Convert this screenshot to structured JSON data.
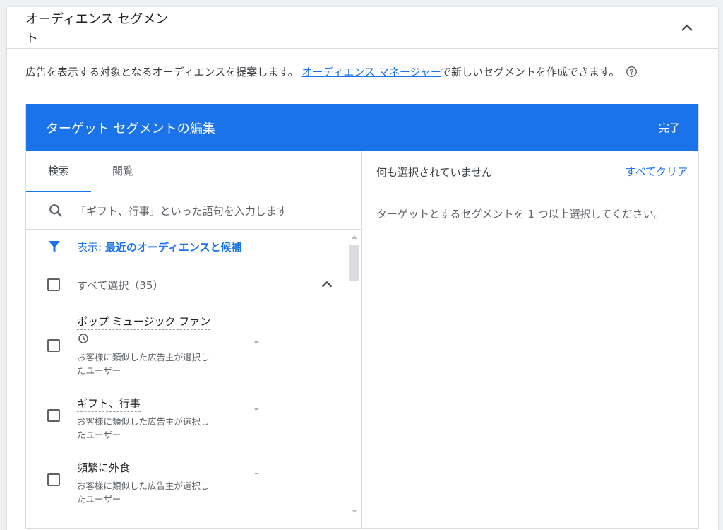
{
  "card": {
    "title": "オーディエンス セグメント",
    "description_prefix": "広告を表示する対象となるオーディエンスを提案します。 ",
    "link_text": "オーディエンス マネージャー",
    "description_suffix": "で新しいセグメントを作成できます。"
  },
  "panel": {
    "title": "ターゲット セグメントの編集",
    "done_label": "完了",
    "tabs": [
      {
        "label": "検索",
        "active": true
      },
      {
        "label": "閲覧",
        "active": false
      }
    ],
    "search": {
      "placeholder": "「ギフト、行事」といった語句を入力します",
      "value": ""
    },
    "filter": {
      "prefix": "表示: ",
      "value": "最近のオーディエンスと候補"
    },
    "select_all_label": "すべて選択（35）",
    "items": [
      {
        "name": "ポップ ミュージック ファン",
        "has_clock_icon": true,
        "sub1": "お客様に類似した広告主が選択し",
        "sub2": "たユーザー",
        "value": "–"
      },
      {
        "name": "ギフト、行事",
        "has_clock_icon": false,
        "sub1": "お客様に類似した広告主が選択し",
        "sub2": "たユーザー",
        "value": "–"
      },
      {
        "name": "頻繁に外食",
        "has_clock_icon": false,
        "sub1": "お客様に類似した広告主が選択し",
        "sub2": "たユーザー",
        "value": "–"
      }
    ],
    "right": {
      "status": "何も選択されていません",
      "clear_all_label": "すべてクリア",
      "empty_message": "ターゲットとするセグメントを 1 つ以上選択してください。"
    }
  },
  "colors": {
    "accent": "#1a73e8",
    "text": "#3c4043",
    "muted": "#5f6368",
    "divider": "#dadce0"
  }
}
